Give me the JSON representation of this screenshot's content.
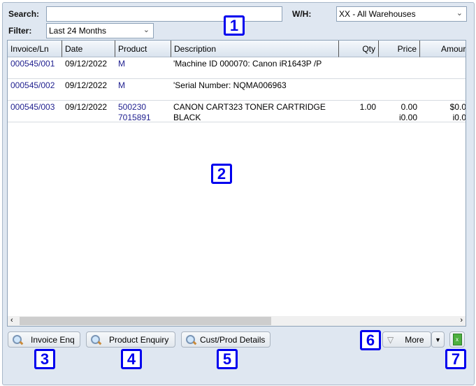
{
  "filters": {
    "search_label": "Search:",
    "search_value": "",
    "wh_label": "W/H:",
    "wh_value": "XX - All Warehouses",
    "filter_label": "Filter:",
    "filter_value": "Last 24 Months"
  },
  "table": {
    "columns": [
      "Invoice/Ln",
      "Date",
      "Product",
      "Description",
      "Qty",
      "Price",
      "Amour"
    ],
    "rows": [
      {
        "invoice": "000545/001",
        "date": "09/12/2022",
        "product": "M",
        "product2": "",
        "desc": "'Machine ID 000070: Canon iR1643P /P",
        "desc2": "",
        "qty": "",
        "price": "",
        "price2": "",
        "amount": "",
        "amount2": ""
      },
      {
        "invoice": "000545/002",
        "date": "09/12/2022",
        "product": "M",
        "product2": "",
        "desc": "'Serial Number: NQMA006963",
        "desc2": "",
        "qty": "",
        "price": "",
        "price2": "",
        "amount": "",
        "amount2": ""
      },
      {
        "invoice": "000545/003",
        "date": "09/12/2022",
        "product": "500230",
        "product2": "7015891",
        "desc": "CANON CART323 TONER CARTRIDGE",
        "desc2": "BLACK",
        "qty": "1.00",
        "price": "0.00",
        "price2": "i0.00",
        "amount": "$0.0",
        "amount2": "i0.0"
      }
    ]
  },
  "buttons": {
    "invoice_enq": "Invoice Enq",
    "product_enquiry": "Product Enquiry",
    "cust_prod": "Cust/Prod Details",
    "more": "More"
  },
  "badges": [
    "1",
    "2",
    "3",
    "4",
    "5",
    "6",
    "7"
  ],
  "colors": {
    "badge": "#0000ee",
    "link": "#1f1f8f",
    "background": "#dfe7f1"
  }
}
